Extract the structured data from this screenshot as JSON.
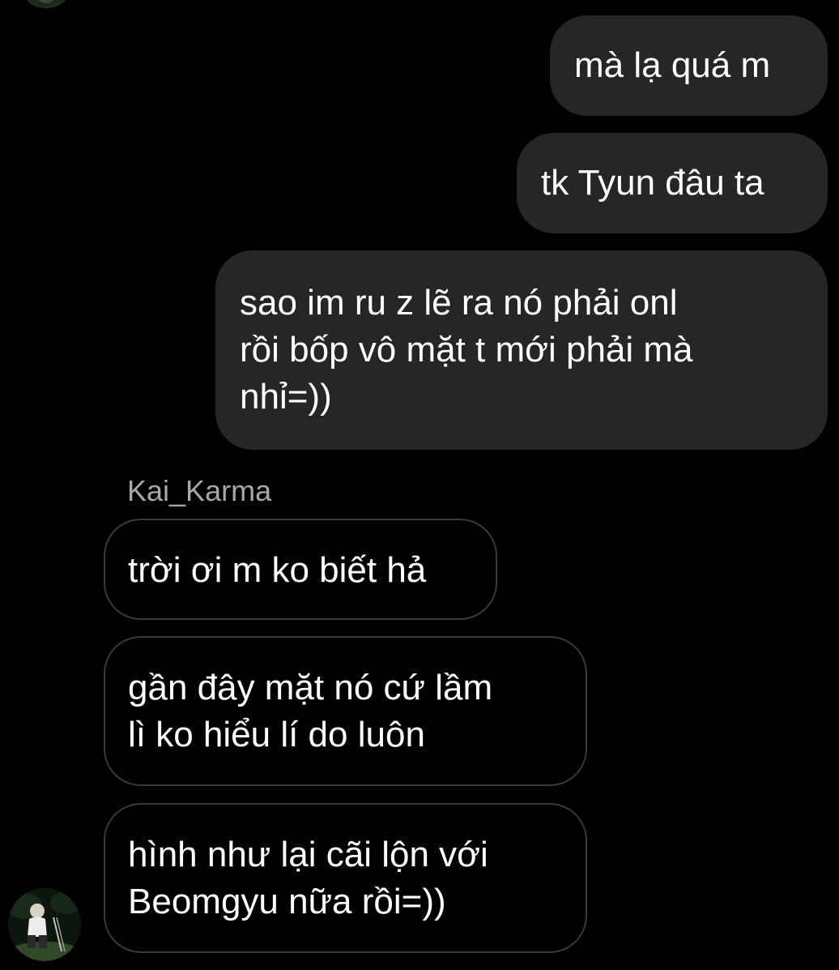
{
  "conversation": {
    "outgoing": [
      {
        "text": "mà lạ quá m"
      },
      {
        "text": "tk Tyun đâu ta"
      },
      {
        "text": "sao im ru z lẽ ra nó phải onl\nrồi bốp vô mặt t mới phải mà\nnhỉ=))"
      }
    ],
    "sender_name": "Kai_Karma",
    "incoming": [
      {
        "text": "trời ơi m ko biết hả"
      },
      {
        "text": "gần đây mặt nó cứ lầm\nlì ko hiểu lí do luôn"
      },
      {
        "text": "hình như lại cãi lộn với\nBeomgyu nữa rồi=))"
      }
    ]
  },
  "colors": {
    "background": "#000000",
    "outgoing_bubble": "#262626",
    "incoming_border": "#3a3a3a",
    "text": "#ffffff",
    "sender_name": "#a8a8a8"
  }
}
